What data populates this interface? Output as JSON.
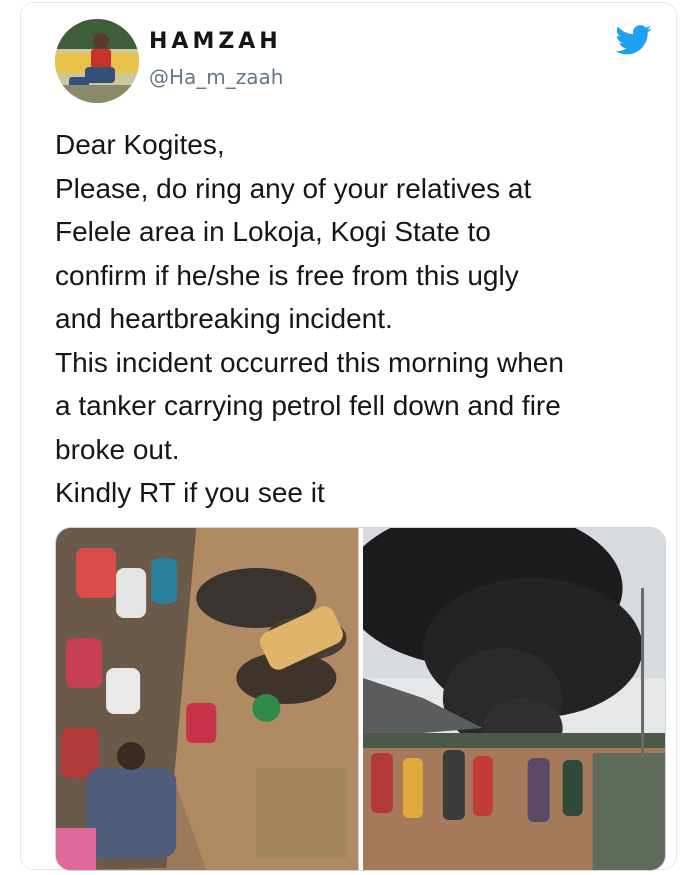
{
  "tweet": {
    "display_name": "HAMZAH",
    "handle": "@Ha_m_zaah",
    "platform_icon": "twitter-bird-icon",
    "brand_color": "#1da1f2",
    "text_lines": [
      "Dear Kogites,",
      "Please, do ring any of your relatives at",
      "Felele area in Lokoja, Kogi State to",
      "confirm if he/she is free from this ugly",
      "and heartbreaking incident.",
      "This incident occurred this morning when",
      "a tanker carrying petrol fell down and fire",
      "broke out.",
      "Kindly RT if you see it"
    ],
    "media": [
      {
        "name": "crowd-scene-photo"
      },
      {
        "name": "smoke-fire-photo"
      }
    ]
  }
}
